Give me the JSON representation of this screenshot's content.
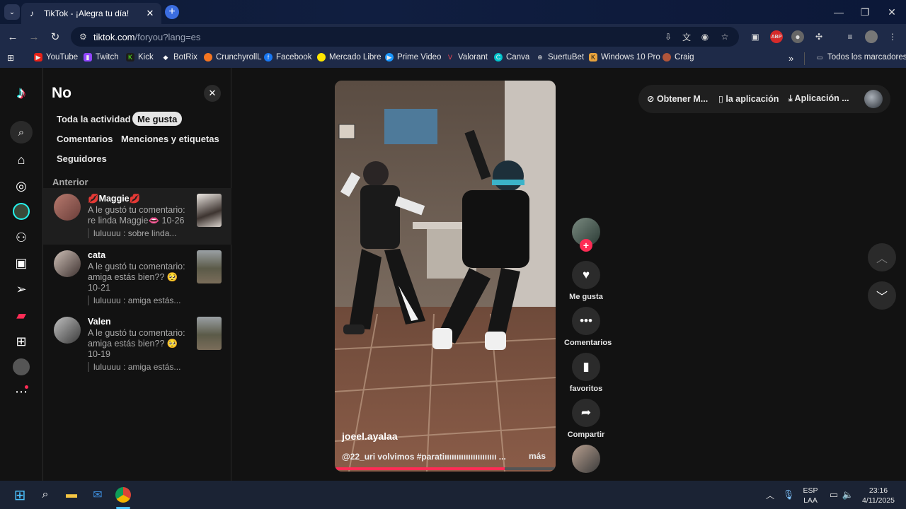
{
  "browser": {
    "tab_title": "TikTok - ¡Alegra tu día!",
    "url_host": "tiktok.com",
    "url_path": "/foryou?lang=es",
    "bookmarks": [
      "YouTube",
      "Twitch",
      "Kick",
      "BotRix",
      "CrunchyrollL",
      "Facebook",
      "Mercado Libre",
      "Prime Video",
      "Valorant",
      "Canva",
      "SuertuBet",
      "Windows 10 Pro",
      "Craig"
    ],
    "all_bookmarks": "Todos los marcadores",
    "overflow": "»"
  },
  "panel": {
    "title": "No",
    "close": "✕",
    "filters": [
      "Toda la actividad",
      "Me gusta",
      "Comentarios",
      "Menciones y etiquetas",
      "Seguidores"
    ],
    "active_filter": "Me gusta",
    "section": "Anterior",
    "notifications": [
      {
        "name": "💋Maggie💋",
        "desc": "A le gustó tu comentario: re linda Maggie👄 10-26",
        "reply": "luluuuu : sobre linda..."
      },
      {
        "name": "cata",
        "desc": "A le gustó tu comentario: amiga estás bien?? 🥺 10-21",
        "reply": "luluuuu : amiga estás..."
      },
      {
        "name": "Valen",
        "desc": "A le gustó tu comentario: amiga estás bien?? 🥺 10-19",
        "reply": "luluuuu : amiga estás..."
      }
    ]
  },
  "video": {
    "author": "joeel.ayalaa",
    "caption": "@22_uri volvimos #paratiıııııııııııııııııııııı ...",
    "more": "más",
    "progress_fraction": 0.77
  },
  "actions": {
    "like": "Me gusta",
    "comments": "Comentarios",
    "favorites": "favoritos",
    "share": "Compartir"
  },
  "top_actions": {
    "coins": "Obtener M...",
    "app": "la aplicación",
    "download": "Aplicación ..."
  },
  "taskbar": {
    "lang_top": "ESP",
    "lang_bottom": "LAA",
    "time": "23:16",
    "date": "4/11/2025"
  },
  "colors": {
    "accent": "#fe2c55",
    "chrome_bg": "#1e2a48",
    "page_bg": "#121212"
  }
}
